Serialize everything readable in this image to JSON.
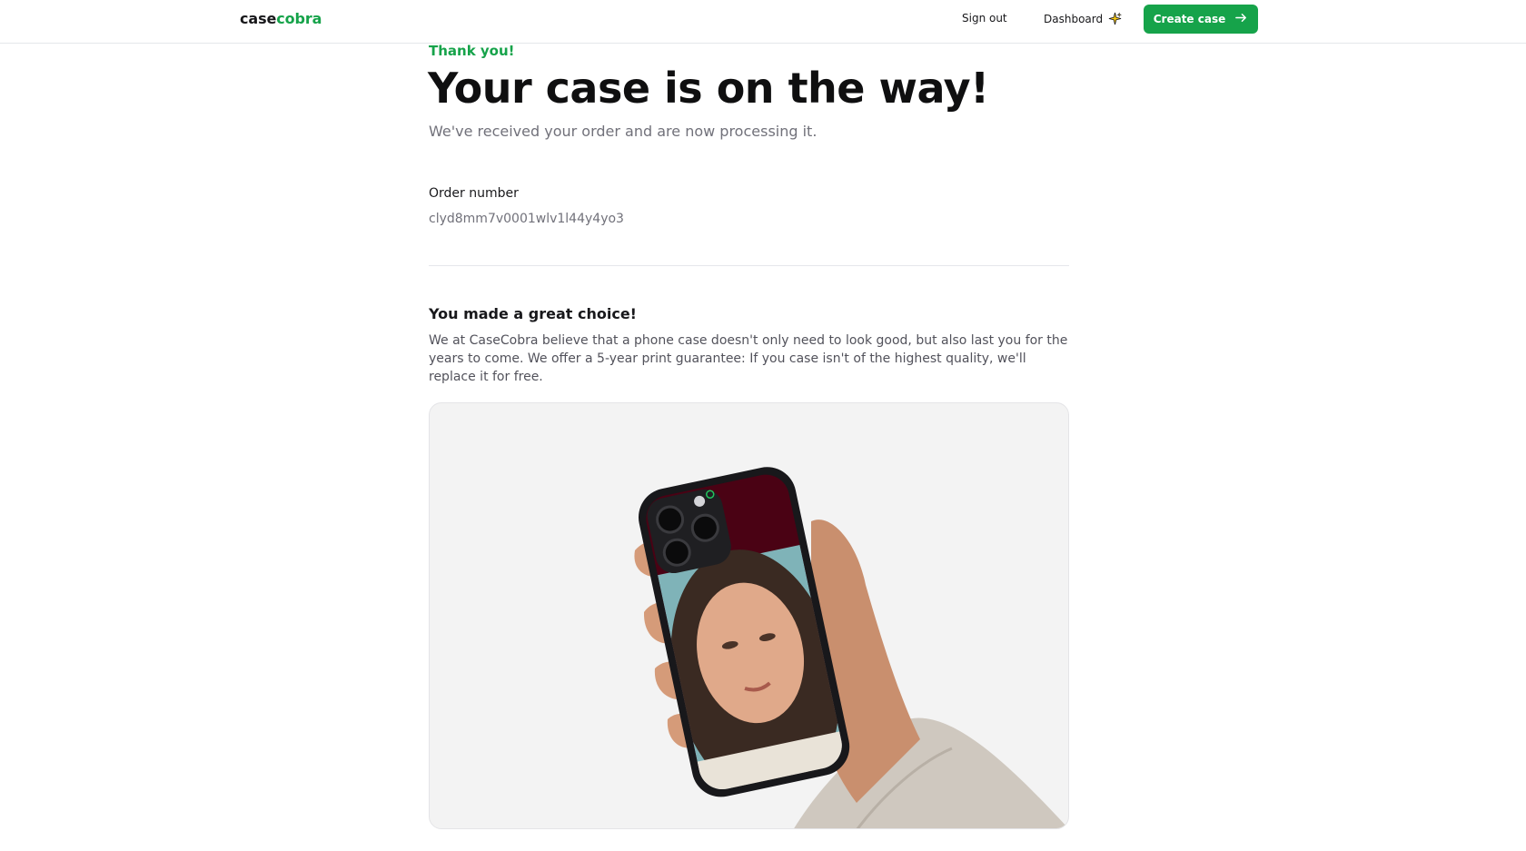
{
  "navbar": {
    "logo_prefix": "case",
    "logo_accent": "cobra",
    "sign_out": "Sign out",
    "dashboard": "Dashboard",
    "dashboard_icon": "sparkles-icon",
    "create_case": "Create case",
    "create_case_icon": "arrow-right-icon"
  },
  "confirmation": {
    "eyebrow": "Thank you!",
    "headline": "Your case is on the way!",
    "subtext": "We've received your order and are now processing it."
  },
  "order": {
    "label": "Order number",
    "value": "clyd8mm7v0001wlv1l44y4yo3"
  },
  "choice": {
    "title": "You made a great choice!",
    "text": "We at CaseCobra believe that a phone case doesn't only need to look good, but also last you for the years to come. We offer a 5-year print guarantee: If you case isn't of the highest quality, we'll replace it for free."
  },
  "preview": {
    "description_icon": "phone-case-preview",
    "case_color": "#4a0214"
  },
  "colors": {
    "brand": "#16a34a",
    "text_primary": "#18181b",
    "text_muted": "#71717a"
  }
}
